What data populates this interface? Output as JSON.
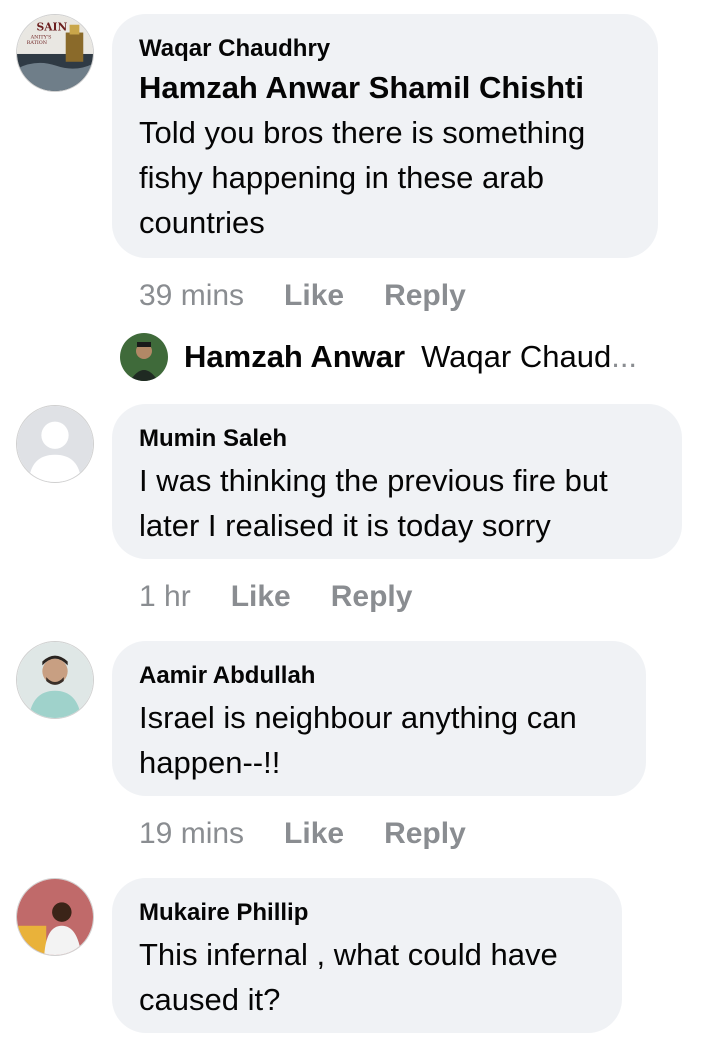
{
  "comments": [
    {
      "author": "Waqar Chaudhry",
      "tag": "Hamzah Anwar Shamil Chishti",
      "text": [
        "Told you bros there is something",
        "fishy happening in these arab",
        "countries"
      ],
      "time": "39 mins",
      "like": "Like",
      "reply": "Reply",
      "avatar_text": [
        "SAIN",
        "ANITY'S",
        "RATION"
      ]
    },
    {
      "author": "Mumin Saleh",
      "text": [
        "I was thinking the previous fire but",
        "later I realised it is today sorry"
      ],
      "time": "1 hr",
      "like": "Like",
      "reply": "Reply"
    },
    {
      "author": "Aamir Abdullah",
      "text": [
        "Israel is neighbour anything can",
        "happen--!!"
      ],
      "time": "19 mins",
      "like": "Like",
      "reply": "Reply"
    },
    {
      "author": "Mukaire Phillip",
      "text": [
        "This infernal , what could have",
        "caused it?"
      ]
    }
  ],
  "reply_preview": {
    "name": "Hamzah Anwar",
    "text": "Waqar Chaud",
    "ellipsis": "..."
  },
  "colors": {
    "bubble": "#f0f2f5",
    "meta": "#8a8d91",
    "text": "#050505"
  }
}
